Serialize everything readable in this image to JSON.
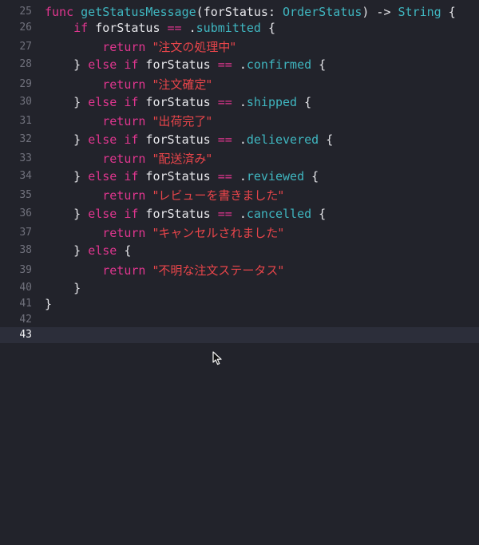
{
  "editor": {
    "current_line": 43,
    "lines": [
      {
        "num": "25",
        "tokens": [
          {
            "t": "func",
            "c": "kw"
          },
          {
            "t": " ",
            "c": "tx"
          },
          {
            "t": "getStatusMessage",
            "c": "fn"
          },
          {
            "t": "(forStatus: ",
            "c": "tx"
          },
          {
            "t": "OrderStatus",
            "c": "ty"
          },
          {
            "t": ") -> ",
            "c": "tx"
          },
          {
            "t": "String",
            "c": "ty"
          },
          {
            "t": " {",
            "c": "tx"
          }
        ]
      },
      {
        "num": "26",
        "tokens": [
          {
            "t": "    ",
            "c": "tx"
          },
          {
            "t": "if",
            "c": "kw"
          },
          {
            "t": " forStatus ",
            "c": "tx"
          },
          {
            "t": "==",
            "c": "kw"
          },
          {
            "t": " .",
            "c": "tx"
          },
          {
            "t": "submitted",
            "c": "mb"
          },
          {
            "t": " {",
            "c": "tx"
          }
        ]
      },
      {
        "num": "27",
        "tokens": [
          {
            "t": "        ",
            "c": "tx"
          },
          {
            "t": "return",
            "c": "kw"
          },
          {
            "t": " ",
            "c": "tx"
          },
          {
            "t": "\"注文の処理中\"",
            "c": "str"
          }
        ]
      },
      {
        "num": "28",
        "tokens": [
          {
            "t": "    } ",
            "c": "tx"
          },
          {
            "t": "else",
            "c": "kw"
          },
          {
            "t": " ",
            "c": "tx"
          },
          {
            "t": "if",
            "c": "kw"
          },
          {
            "t": " forStatus ",
            "c": "tx"
          },
          {
            "t": "==",
            "c": "kw"
          },
          {
            "t": " .",
            "c": "tx"
          },
          {
            "t": "confirmed",
            "c": "mb"
          },
          {
            "t": " {",
            "c": "tx"
          }
        ]
      },
      {
        "num": "29",
        "tokens": [
          {
            "t": "        ",
            "c": "tx"
          },
          {
            "t": "return",
            "c": "kw"
          },
          {
            "t": " ",
            "c": "tx"
          },
          {
            "t": "\"注文確定\"",
            "c": "str"
          }
        ]
      },
      {
        "num": "30",
        "tokens": [
          {
            "t": "    } ",
            "c": "tx"
          },
          {
            "t": "else",
            "c": "kw"
          },
          {
            "t": " ",
            "c": "tx"
          },
          {
            "t": "if",
            "c": "kw"
          },
          {
            "t": " forStatus ",
            "c": "tx"
          },
          {
            "t": "==",
            "c": "kw"
          },
          {
            "t": " .",
            "c": "tx"
          },
          {
            "t": "shipped",
            "c": "mb"
          },
          {
            "t": " {",
            "c": "tx"
          }
        ]
      },
      {
        "num": "31",
        "tokens": [
          {
            "t": "        ",
            "c": "tx"
          },
          {
            "t": "return",
            "c": "kw"
          },
          {
            "t": " ",
            "c": "tx"
          },
          {
            "t": "\"出荷完了\"",
            "c": "str"
          }
        ]
      },
      {
        "num": "32",
        "tokens": [
          {
            "t": "    } ",
            "c": "tx"
          },
          {
            "t": "else",
            "c": "kw"
          },
          {
            "t": " ",
            "c": "tx"
          },
          {
            "t": "if",
            "c": "kw"
          },
          {
            "t": " forStatus ",
            "c": "tx"
          },
          {
            "t": "==",
            "c": "kw"
          },
          {
            "t": " .",
            "c": "tx"
          },
          {
            "t": "delievered",
            "c": "mb"
          },
          {
            "t": " {",
            "c": "tx"
          }
        ]
      },
      {
        "num": "33",
        "tokens": [
          {
            "t": "        ",
            "c": "tx"
          },
          {
            "t": "return",
            "c": "kw"
          },
          {
            "t": " ",
            "c": "tx"
          },
          {
            "t": "\"配送済み\"",
            "c": "str"
          }
        ]
      },
      {
        "num": "34",
        "tokens": [
          {
            "t": "    } ",
            "c": "tx"
          },
          {
            "t": "else",
            "c": "kw"
          },
          {
            "t": " ",
            "c": "tx"
          },
          {
            "t": "if",
            "c": "kw"
          },
          {
            "t": " forStatus ",
            "c": "tx"
          },
          {
            "t": "==",
            "c": "kw"
          },
          {
            "t": " .",
            "c": "tx"
          },
          {
            "t": "reviewed",
            "c": "mb"
          },
          {
            "t": " {",
            "c": "tx"
          }
        ]
      },
      {
        "num": "35",
        "tokens": [
          {
            "t": "        ",
            "c": "tx"
          },
          {
            "t": "return",
            "c": "kw"
          },
          {
            "t": " ",
            "c": "tx"
          },
          {
            "t": "\"レビューを書きました\"",
            "c": "str"
          }
        ]
      },
      {
        "num": "36",
        "tokens": [
          {
            "t": "    } ",
            "c": "tx"
          },
          {
            "t": "else",
            "c": "kw"
          },
          {
            "t": " ",
            "c": "tx"
          },
          {
            "t": "if",
            "c": "kw"
          },
          {
            "t": " forStatus ",
            "c": "tx"
          },
          {
            "t": "==",
            "c": "kw"
          },
          {
            "t": " .",
            "c": "tx"
          },
          {
            "t": "cancelled",
            "c": "mb"
          },
          {
            "t": " {",
            "c": "tx"
          }
        ]
      },
      {
        "num": "37",
        "tokens": [
          {
            "t": "        ",
            "c": "tx"
          },
          {
            "t": "return",
            "c": "kw"
          },
          {
            "t": " ",
            "c": "tx"
          },
          {
            "t": "\"キャンセルされました\"",
            "c": "str"
          }
        ]
      },
      {
        "num": "38",
        "tokens": [
          {
            "t": "    } ",
            "c": "tx"
          },
          {
            "t": "else",
            "c": "kw"
          },
          {
            "t": " {",
            "c": "tx"
          }
        ]
      },
      {
        "num": "39",
        "tokens": [
          {
            "t": "        ",
            "c": "tx"
          },
          {
            "t": "return",
            "c": "kw"
          },
          {
            "t": " ",
            "c": "tx"
          },
          {
            "t": "\"不明な注文ステータス\"",
            "c": "str"
          }
        ]
      },
      {
        "num": "40",
        "tokens": [
          {
            "t": "    }",
            "c": "tx"
          }
        ]
      },
      {
        "num": "41",
        "tokens": [
          {
            "t": "}",
            "c": "tx"
          }
        ]
      },
      {
        "num": "42",
        "tokens": []
      },
      {
        "num": "43",
        "tokens": []
      }
    ]
  },
  "colors": {
    "background": "#22232b",
    "current_line": "#2c2e3a",
    "keyword": "#e0368f",
    "type": "#3fb6c0",
    "string": "#e8454a",
    "text": "#e6e6ea",
    "gutter": "#70717c"
  },
  "icons": {
    "cursor": "mouse-pointer-icon"
  }
}
